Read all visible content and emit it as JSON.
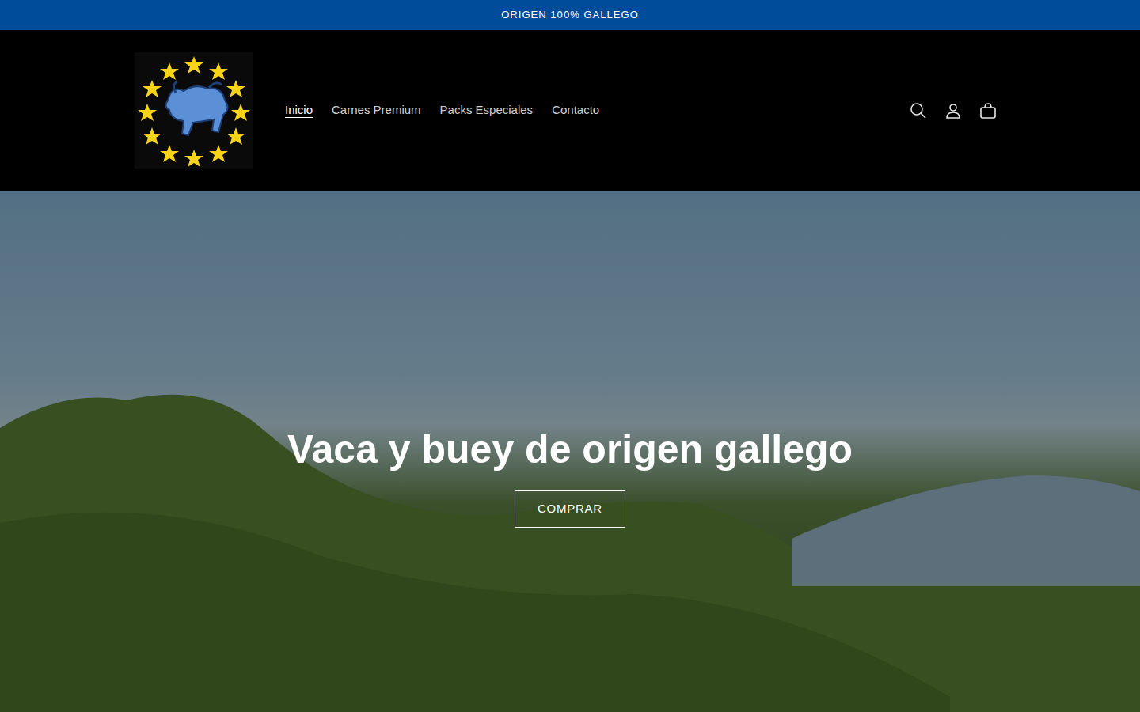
{
  "announcement": "ORIGEN 100% GALLEGO",
  "nav": {
    "items": [
      {
        "label": "Inicio",
        "selected": true
      },
      {
        "label": "Carnes Premium",
        "selected": false
      },
      {
        "label": "Packs Especiales",
        "selected": false
      },
      {
        "label": "Contacto",
        "selected": false
      }
    ]
  },
  "hero": {
    "heading": "Vaca y buey de origen gallego",
    "button": "COMPRAR"
  }
}
